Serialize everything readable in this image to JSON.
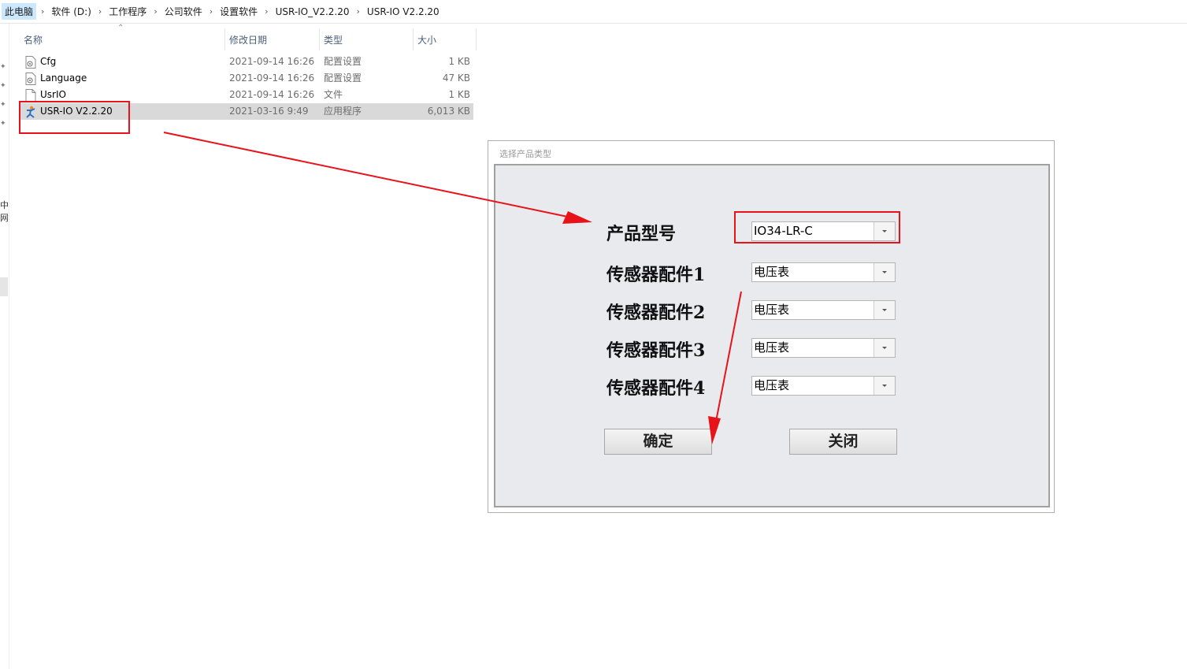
{
  "breadcrumb": [
    "此电脑",
    "软件 (D:)",
    "工作程序",
    "公司软件",
    "设置软件",
    "USR-IO_V2.2.20",
    "USR-IO V2.2.20"
  ],
  "left_strip": {
    "text": "中网"
  },
  "file_list": {
    "columns": {
      "name": "名称",
      "date": "修改日期",
      "type": "类型",
      "size": "大小"
    },
    "rows": [
      {
        "name": "Cfg",
        "date": "2021-09-14 16:26",
        "type": "配置设置",
        "size": "1 KB",
        "icon": "config-file-icon"
      },
      {
        "name": "Language",
        "date": "2021-09-14 16:26",
        "type": "配置设置",
        "size": "47 KB",
        "icon": "config-file-icon"
      },
      {
        "name": "UsrIO",
        "date": "2021-09-14 16:26",
        "type": "文件",
        "size": "1 KB",
        "icon": "blank-file-icon"
      },
      {
        "name": "USR-IO V2.2.20",
        "date": "2021-03-16 9:49",
        "type": "应用程序",
        "size": "6,013 KB",
        "icon": "app-icon",
        "selected": true
      }
    ]
  },
  "dialog": {
    "title": "选择产品类型",
    "fields": [
      {
        "label": "产品型号",
        "value": "IO34-LR-C"
      },
      {
        "label": "传感器配件1",
        "value": "电压表"
      },
      {
        "label": "传感器配件2",
        "value": "电压表"
      },
      {
        "label": "传感器配件3",
        "value": "电压表"
      },
      {
        "label": "传感器配件4",
        "value": "电压表"
      }
    ],
    "confirm_label": "确定",
    "close_label": "关闭"
  },
  "colors": {
    "annotation_red": "#e8131a",
    "selected_row": "#d9d9d9",
    "panel_bg": "#e8eaee"
  }
}
